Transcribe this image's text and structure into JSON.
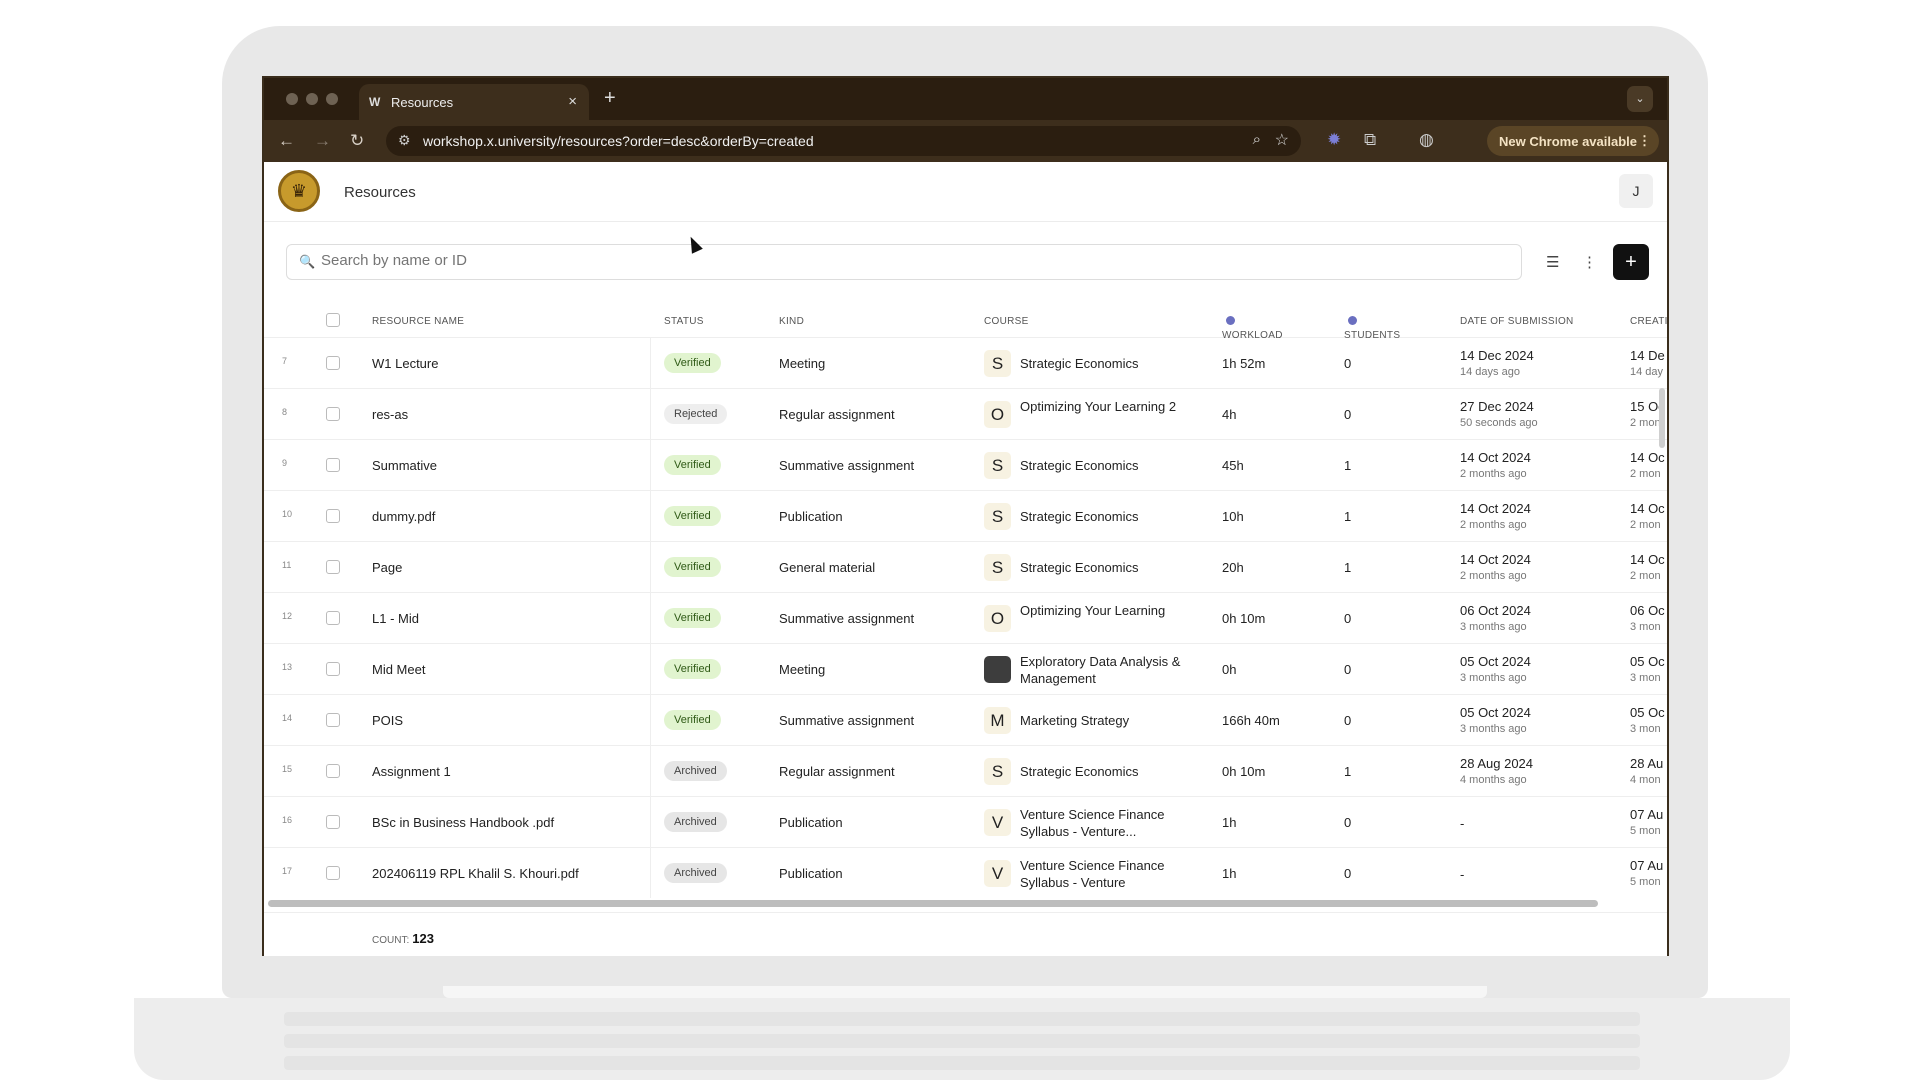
{
  "browser": {
    "tab_title": "Resources",
    "tab_favicon": "W",
    "url": "workshop.x.university/resources?order=desc&orderBy=created",
    "update_label": "New Chrome available"
  },
  "app": {
    "title": "Resources",
    "user_initial": "J",
    "search_placeholder": "Search by name or ID",
    "colors": {
      "badge_verified": "#e1f4cf",
      "accent_dark": "#111111",
      "chrome_bg": "#2b1e10"
    }
  },
  "columns": {
    "name": "RESOURCE NAME",
    "status": "STATUS",
    "kind": "KIND",
    "course": "COURSE",
    "workload": "WORKLOAD",
    "students": "STUDENTS",
    "submission": "DATE OF SUBMISSION",
    "creation": "CREATIO"
  },
  "rows": [
    {
      "n": "7",
      "name": "W1 Lecture",
      "status": "Verified",
      "status_type": "verified",
      "kind": "Meeting",
      "course_icon": "S",
      "course": "Strategic Economics",
      "workload": "1h 52m",
      "students": "0",
      "date": "14 Dec 2024",
      "date_rel": "14 days ago",
      "created": "14 De",
      "created_rel": "14 day"
    },
    {
      "n": "8",
      "name": "res-as",
      "status": "Rejected",
      "status_type": "rejected",
      "kind": "Regular assignment",
      "course_icon": "O",
      "course": "Optimizing Your Learning 2",
      "workload": "4h",
      "students": "0",
      "date": "27 Dec 2024",
      "date_rel": "50 seconds ago",
      "created": "15 Oc",
      "created_rel": "2 mon"
    },
    {
      "n": "9",
      "name": "Summative",
      "status": "Verified",
      "status_type": "verified",
      "kind": "Summative assignment",
      "course_icon": "S",
      "course": "Strategic Economics",
      "workload": "45h",
      "students": "1",
      "date": "14 Oct 2024",
      "date_rel": "2 months ago",
      "created": "14 Oc",
      "created_rel": "2 mon"
    },
    {
      "n": "10",
      "name": "dummy.pdf",
      "status": "Verified",
      "status_type": "verified",
      "kind": "Publication",
      "course_icon": "S",
      "course": "Strategic Economics",
      "workload": "10h",
      "students": "1",
      "date": "14 Oct 2024",
      "date_rel": "2 months ago",
      "created": "14 Oc",
      "created_rel": "2 mon"
    },
    {
      "n": "11",
      "name": "Page",
      "status": "Verified",
      "status_type": "verified",
      "kind": "General material",
      "course_icon": "S",
      "course": "Strategic Economics",
      "workload": "20h",
      "students": "1",
      "date": "14 Oct 2024",
      "date_rel": "2 months ago",
      "created": "14 Oc",
      "created_rel": "2 mon"
    },
    {
      "n": "12",
      "name": "L1 - Mid",
      "status": "Verified",
      "status_type": "verified",
      "kind": "Summative assignment",
      "course_icon": "O",
      "course": "Optimizing Your Learning",
      "workload": "0h 10m",
      "students": "0",
      "date": "06 Oct 2024",
      "date_rel": "3 months ago",
      "created": "06 Oc",
      "created_rel": "3 mon"
    },
    {
      "n": "13",
      "name": "Mid Meet",
      "status": "Verified",
      "status_type": "verified",
      "kind": "Meeting",
      "course_icon": "",
      "course": "Exploratory Data Analysis & Management",
      "workload": "0h",
      "students": "0",
      "date": "05 Oct 2024",
      "date_rel": "3 months ago",
      "created": "05 Oc",
      "created_rel": "3 mon"
    },
    {
      "n": "14",
      "name": "POIS",
      "status": "Verified",
      "status_type": "verified",
      "kind": "Summative assignment",
      "course_icon": "M",
      "course": "Marketing Strategy",
      "workload": "166h 40m",
      "students": "0",
      "date": "05 Oct 2024",
      "date_rel": "3 months ago",
      "created": "05 Oc",
      "created_rel": "3 mon"
    },
    {
      "n": "15",
      "name": "Assignment 1",
      "status": "Archived",
      "status_type": "archived",
      "kind": "Regular assignment",
      "course_icon": "S",
      "course": "Strategic Economics",
      "workload": "0h 10m",
      "students": "1",
      "date": "28 Aug 2024",
      "date_rel": "4 months ago",
      "created": "28 Au",
      "created_rel": "4 mon"
    },
    {
      "n": "16",
      "name": "BSc in Business Handbook .pdf",
      "status": "Archived",
      "status_type": "archived",
      "kind": "Publication",
      "course_icon": "V",
      "course": "Venture Science Finance Syllabus - Venture...",
      "workload": "1h",
      "students": "0",
      "date": "-",
      "date_rel": "",
      "created": "07 Au",
      "created_rel": "5 mon"
    },
    {
      "n": "17",
      "name": "202406119 RPL Khalil S. Khouri.pdf",
      "status": "Archived",
      "status_type": "archived",
      "kind": "Publication",
      "course_icon": "V",
      "course": "Venture Science Finance Syllabus - Venture",
      "workload": "1h",
      "students": "0",
      "date": "-",
      "date_rel": "",
      "created": "07 Au",
      "created_rel": "5 mon"
    }
  ],
  "footer": {
    "count_label": "COUNT:",
    "count": "123"
  }
}
